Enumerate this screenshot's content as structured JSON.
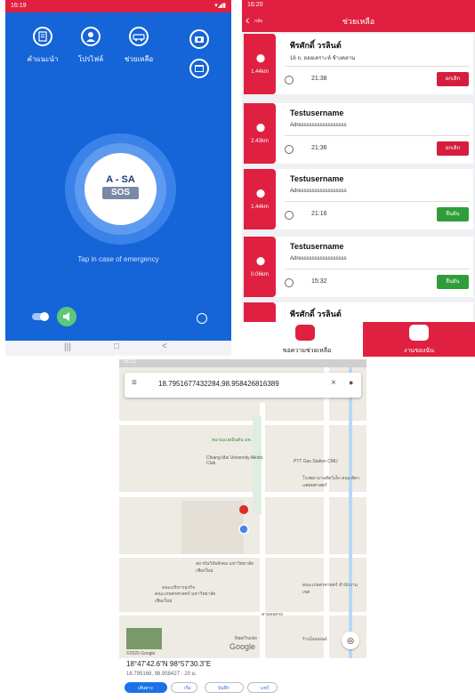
{
  "colors": {
    "brand_red": "#e02040",
    "blue_bg": "#1565d8",
    "ok_green": "#2f9d3a",
    "map_blue": "#1a73e8"
  },
  "home": {
    "status_time": "16:19",
    "menu": [
      {
        "label": "คำแนะนำ",
        "icon": "document-icon"
      },
      {
        "label": "โปรไฟล์",
        "icon": "profile-icon"
      },
      {
        "label": "ช่วยเหลือ",
        "icon": "rescue-icon"
      }
    ],
    "logo_top": "A - SA",
    "logo_bottom": "SOS",
    "tap_text": "Tap in case of emergency"
  },
  "help": {
    "status_time": "16:20",
    "back_label": "กลับ",
    "title": "ช่วยเหลือ",
    "cards": [
      {
        "name": "พีรศักดิ์ วรลินต์",
        "address": "16 ถ. ลอยเคราะห์ ช้างคลาน",
        "distance": "1.44km",
        "time": "21:38",
        "action": "ยกเลิก",
        "action_color": "red"
      },
      {
        "name": "Testusername",
        "address": "Adresssssssssssssssss",
        "distance": "2.43km",
        "time": "21:36",
        "action": "ยกเลิก",
        "action_color": "red"
      },
      {
        "name": "Testusername",
        "address": "Adresssssssssssssssss",
        "distance": "1.44km",
        "time": "21:16",
        "action": "ยืนยัน",
        "action_color": "green"
      },
      {
        "name": "Testusername",
        "address": "Adresssssssssssssssss",
        "distance": "0.06km",
        "time": "15:32",
        "action": "ยืนยัน",
        "action_color": "green"
      },
      {
        "name": "พีรศักดิ์ วรลินต์"
      }
    ],
    "tabs": [
      {
        "label": "ขอความช่วยเหลือ"
      },
      {
        "label": "งานของฉัน"
      }
    ]
  },
  "map": {
    "status_time": "16:21",
    "search_value": "18.7951677432284,98.958426816389",
    "places": [
      {
        "label": "สนามแบดมินตัน มช."
      },
      {
        "label": "Chiang Mai University Aikido Club"
      },
      {
        "label": "PTT Gas Station CMU"
      },
      {
        "label": "โรงพยาบาลสัตว์เล็ก คณะสัตวแพทยศาสตร์"
      },
      {
        "label": "สถาบันวิจัยสังคม มหาวิทยาลัยเชียงใหม่"
      },
      {
        "label": "คณะบริหารธุรกิจ"
      },
      {
        "label": "คณะเกษตรศาสตร์ มหาวิทยาลัยเชียงใหม่"
      },
      {
        "label": "คณะเกษตรศาสตร์ สำนักงานเขต"
      },
      {
        "label": "ลานจอดรถ"
      },
      {
        "label": "RawTrucks"
      },
      {
        "label": "ร้านไดมอนด์"
      },
      {
        "label": "Google"
      },
      {
        "label": "©2020 Google"
      }
    ],
    "coords_dms": "18°47'42.6\"N 98°57'30.3\"E",
    "coords_dec": "18.795168, 98.958427 · 20 ม.",
    "actions": [
      {
        "label": "เส้นทาง"
      },
      {
        "label": "เริ่ม"
      },
      {
        "label": "บันทึก"
      },
      {
        "label": "แชร์"
      }
    ]
  }
}
